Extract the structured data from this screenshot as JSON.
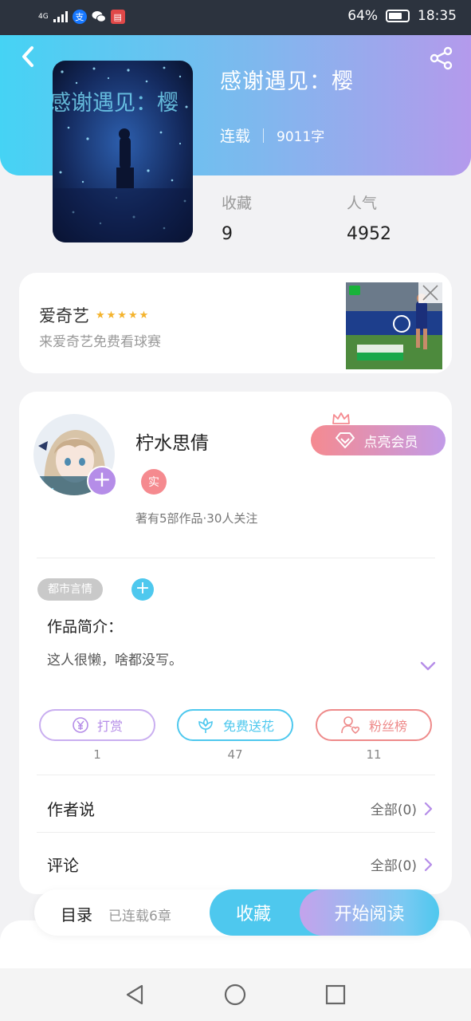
{
  "status_bar": {
    "signal": "4G",
    "battery": "64%",
    "time": "18:35",
    "icons": [
      "signal-icon",
      "alipay-icon",
      "wechat-icon",
      "reader-icon",
      "battery-icon"
    ]
  },
  "header": {
    "back_icon": "chevron-left-icon",
    "share_icon": "share-icon"
  },
  "book": {
    "title": "感谢遇见：樱",
    "status": "连载",
    "word_count": "9011字",
    "favorites_label": "收藏",
    "favorites_value": "9",
    "popularity_label": "人气",
    "popularity_value": "4952"
  },
  "ad": {
    "name": "爱奇艺",
    "rating_stars": 5,
    "subtitle": "来爱奇艺免费看球赛"
  },
  "author": {
    "name": "柠水思倩",
    "verified_badge": "实",
    "stats": "著有5部作品·30人关注",
    "vip_button": "点亮会员"
  },
  "work": {
    "tag": "都市言情",
    "intro_title": "作品简介：",
    "intro_text": "这人很懒，啥都没写。"
  },
  "actions": [
    {
      "label": "打赏",
      "count": "1",
      "icon": "yuan-coin-icon",
      "color": "#b58de8"
    },
    {
      "label": "免费送花",
      "count": "47",
      "icon": "flower-icon",
      "color": "#4ec8ee"
    },
    {
      "label": "粉丝榜",
      "count": "11",
      "icon": "fan-user-icon",
      "color": "#ee8a8a"
    }
  ],
  "sections": {
    "author_says": {
      "label": "作者说",
      "value": "全部(0)"
    },
    "comments": {
      "label": "评论",
      "value": "全部(0)"
    }
  },
  "bottom_bar": {
    "toc": "目录",
    "chapters": "已连载6章",
    "collect": "收藏",
    "read": "开始阅读"
  },
  "colors": {
    "accent_cyan": "#4ec8ee",
    "accent_purple": "#b58de8",
    "accent_pink": "#ee8a8a",
    "star": "#f4b32c"
  }
}
